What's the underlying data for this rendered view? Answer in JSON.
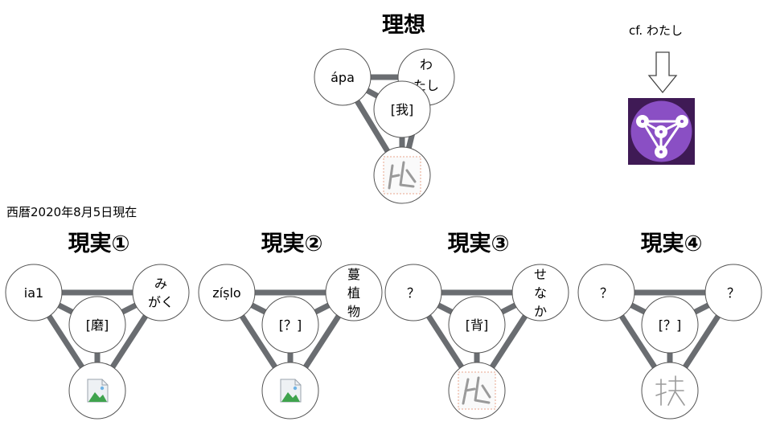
{
  "ideal": {
    "title": "理想",
    "nodes": {
      "left": "ápa",
      "right": [
        "わ",
        "たし"
      ],
      "center": "[我]",
      "bottom": "glyph-image"
    }
  },
  "reference": {
    "label": "cf. わたし",
    "arrow": "down-arrow-icon",
    "logo_colors": {
      "bg": "#3f1a55",
      "disc": "#8a4fc4"
    }
  },
  "date_note": "西暦2020年8月5日現在",
  "realities": [
    {
      "title": "現実①",
      "left": [
        "ia1"
      ],
      "right": [
        "み",
        "がく"
      ],
      "center": "[磨]",
      "bottom": "broken-image-icon"
    },
    {
      "title": "現実②",
      "left": [
        "zíṣlo"
      ],
      "right": [
        "蔓",
        "植",
        "物"
      ],
      "center": "[？]",
      "bottom": "broken-image-icon"
    },
    {
      "title": "現実③",
      "left": [
        "？"
      ],
      "right": [
        "せ",
        "な",
        "か"
      ],
      "center": "[背]",
      "bottom": "glyph-image"
    },
    {
      "title": "現実④",
      "left": [
        "？"
      ],
      "right": [
        "？"
      ],
      "center": "[？]",
      "bottom": "handwritten-glyph-image"
    }
  ],
  "colors": {
    "edge": "#6a6d71",
    "node_stroke": "#555555",
    "node_fill": "#ffffff"
  }
}
